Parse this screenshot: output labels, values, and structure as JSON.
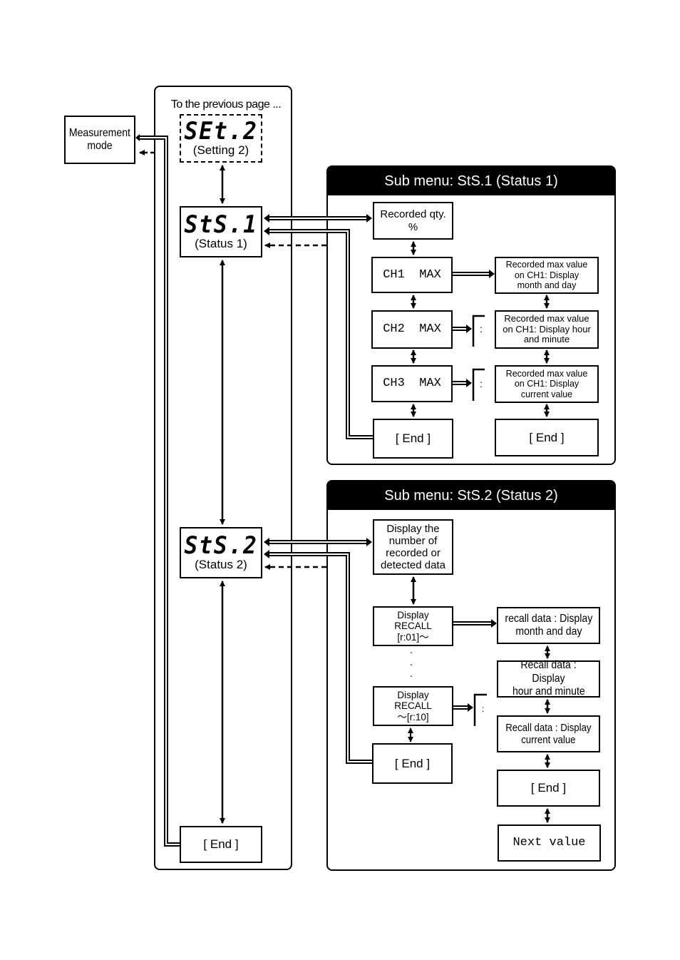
{
  "main_column": {
    "caption": "To the previous page ...",
    "set2": {
      "code": "SEt.2",
      "label": "(Setting 2)"
    },
    "sts1": {
      "code": "StS.1",
      "label": "(Status 1)"
    },
    "sts2": {
      "code": "StS.2",
      "label": "(Status 2)"
    },
    "end": "[ End ]"
  },
  "measurement_mode": {
    "line1": "Measurement",
    "line2": "mode"
  },
  "submenu1": {
    "title": "Sub menu: StS.1 (Status 1)",
    "recorded_qty": {
      "line1": "Recorded qty.",
      "line2": "%"
    },
    "ch1": "CH1  MAX",
    "ch2": "CH2  MAX",
    "ch3": "CH3  MAX",
    "end_left": "[ End ]",
    "detail_month": {
      "line1": "Recorded max value",
      "line2": "on CH1: Display",
      "line3": "month and day"
    },
    "detail_hour": {
      "line1": "Recorded max value",
      "line2": "on CH1: Display hour",
      "line3": "and minute"
    },
    "detail_current": {
      "line1": "Recorded max value",
      "line2": "on CH1: Display",
      "line3": "current value"
    },
    "end_right": "[ End ]",
    "ellipsis": ":"
  },
  "submenu2": {
    "title": "Sub menu: StS.2 (Status 2)",
    "display_number": {
      "line1": "Display the",
      "line2": "number of",
      "line3": "recorded or",
      "line4": "detected data"
    },
    "recall_first": {
      "line1": "Display",
      "line2": "RECALL",
      "line3": "[r:01]〜"
    },
    "recall_last": {
      "line1": "Display",
      "line2": "RECALL",
      "line3": "〜[r:10]"
    },
    "vertical_dots": ".",
    "end_left": "[ End ]",
    "recall_month": {
      "line1": "recall data : Display",
      "line2": "month and day"
    },
    "recall_hour": {
      "line1": "Recall data : Display",
      "line2": "hour and minute"
    },
    "recall_current": {
      "line1": "Recall data : Display",
      "line2": "current value"
    },
    "end_right": "[ End ]",
    "next_value": "Next value",
    "ellipsis": ":"
  }
}
